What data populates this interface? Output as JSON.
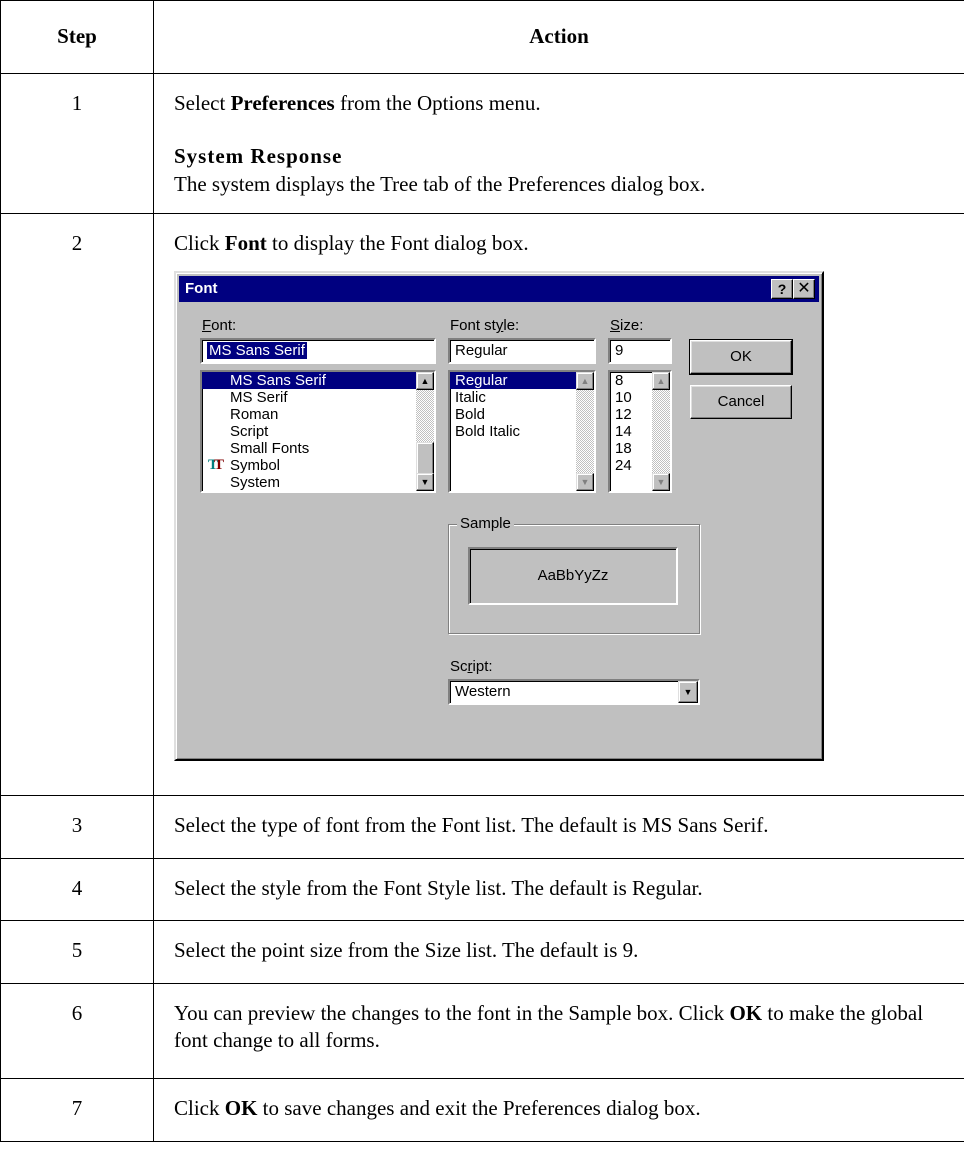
{
  "table": {
    "header": {
      "step": "Step",
      "action": "Action"
    },
    "steps": [
      {
        "num": "1",
        "text_before": "Select ",
        "bold": "Preferences",
        "text_after": " from the Options menu.",
        "response_heading": "System Response",
        "response_text": "The system displays the Tree tab of the Preferences dialog box."
      },
      {
        "num": "2",
        "text_before": "Click ",
        "bold": "Font",
        "text_after": " to display the Font dialog box."
      },
      {
        "num": "3",
        "text": "Select the type of font from the Font list. The default is MS Sans Serif."
      },
      {
        "num": "4",
        "text": "Select the style from the Font Style list. The default is Regular."
      },
      {
        "num": "5",
        "text": "Select the point size from the Size list. The default is 9."
      },
      {
        "num": "6",
        "text_before": "You can preview the changes to the font in the Sample box. Click ",
        "bold": "OK",
        "text_after": " to make the global font change to all forms."
      },
      {
        "num": "7",
        "text_before": "Click ",
        "bold": "OK",
        "text_after": " to save changes and exit the Preferences dialog box."
      }
    ]
  },
  "font_dialog": {
    "title": "Font",
    "help_button": "?",
    "close_button": "✕",
    "font": {
      "label_underlined": "F",
      "label_rest": "ont:",
      "value": "MS Sans Serif",
      "items": [
        "MS Sans Serif",
        "MS Serif",
        "Roman",
        "Script",
        "Small Fonts",
        "Symbol",
        "System"
      ],
      "selected_index": 0,
      "truetype_item_index": 5
    },
    "style": {
      "label_before": "Font st",
      "label_underlined": "y",
      "label_rest": "le:",
      "value": "Regular",
      "items": [
        "Regular",
        "Italic",
        "Bold",
        "Bold Italic"
      ],
      "selected_index": 0
    },
    "size": {
      "label_underlined": "S",
      "label_rest": "ize:",
      "value": "9",
      "items": [
        "8",
        "10",
        "12",
        "14",
        "18",
        "24"
      ]
    },
    "ok_label": "OK",
    "cancel_label": "Cancel",
    "sample": {
      "title": "Sample",
      "text": "AaBbYyZz"
    },
    "script": {
      "label_before": "Sc",
      "label_underlined": "r",
      "label_rest": "ipt:",
      "value": "Western"
    },
    "icons": {
      "truetype": "truetype-icon",
      "scroll_up": "arrow-up-icon",
      "scroll_down": "arrow-down-icon",
      "dropdown": "chevron-down-icon"
    }
  }
}
